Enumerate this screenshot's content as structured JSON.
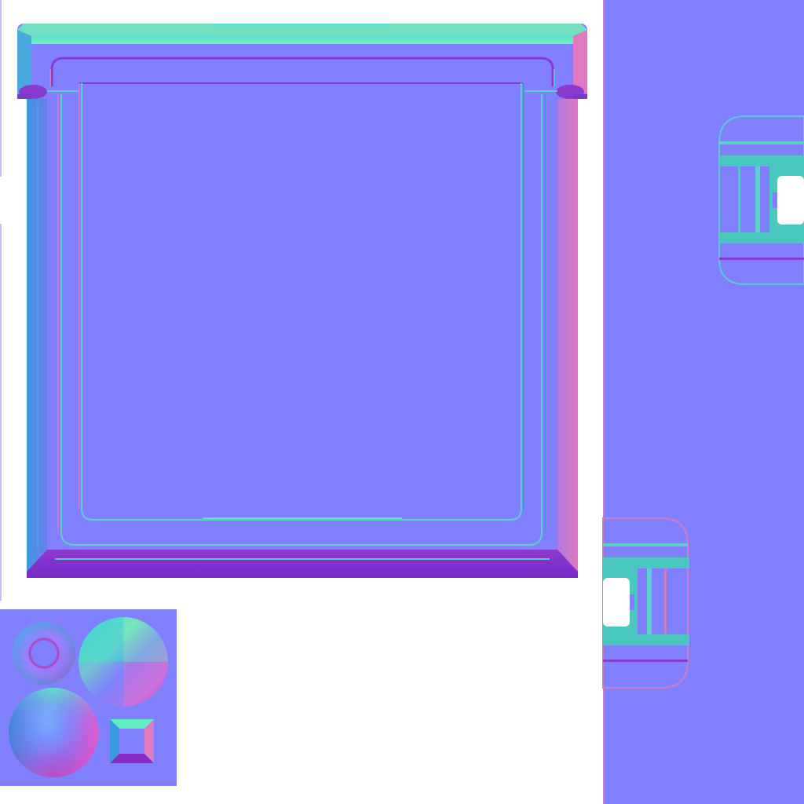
{
  "image": {
    "kind": "normal-map-texture-atlas",
    "text_labels": []
  },
  "palette": {
    "flat_normal": "#8080ff",
    "background": "#ffffff",
    "bevel_top": "#60f0c0",
    "bevel_bottom": "#8a2ac8",
    "bevel_left": "#4a8ae0",
    "bevel_right": "#d37ac8",
    "groove_light": "#a0a0ff",
    "groove_dark": "#5a5ae0",
    "clip_face": "#5ad0c8"
  },
  "shapes": {
    "main_panel": "beveled-square-panel",
    "clip_upper_right": "rail-clip-piece",
    "clip_lower_center": "rail-clip-piece",
    "right_strip": "flat-normal-strip",
    "legend_swatch": "normal-map-reference-shapes",
    "legend_items": [
      "torus",
      "cone",
      "sphere",
      "beveled-square"
    ]
  }
}
